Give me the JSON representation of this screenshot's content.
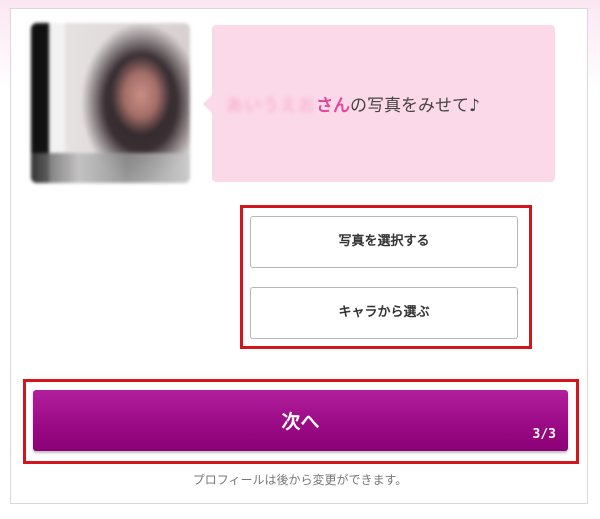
{
  "prompt": {
    "name_blurred": "あいうえお",
    "honorific": "さん",
    "message": "の写真をみせて♪"
  },
  "buttons": {
    "select_photo": "写真を選択する",
    "choose_character": "キャラから選ぶ",
    "next": "次へ"
  },
  "progress": {
    "step": "3/3"
  },
  "footnote": "プロフィールは後から変更ができます。",
  "colors": {
    "accent": "#9c0b86",
    "bubble": "#fcd9e8",
    "highlight": "#d3151c",
    "honorific": "#e2479b"
  }
}
